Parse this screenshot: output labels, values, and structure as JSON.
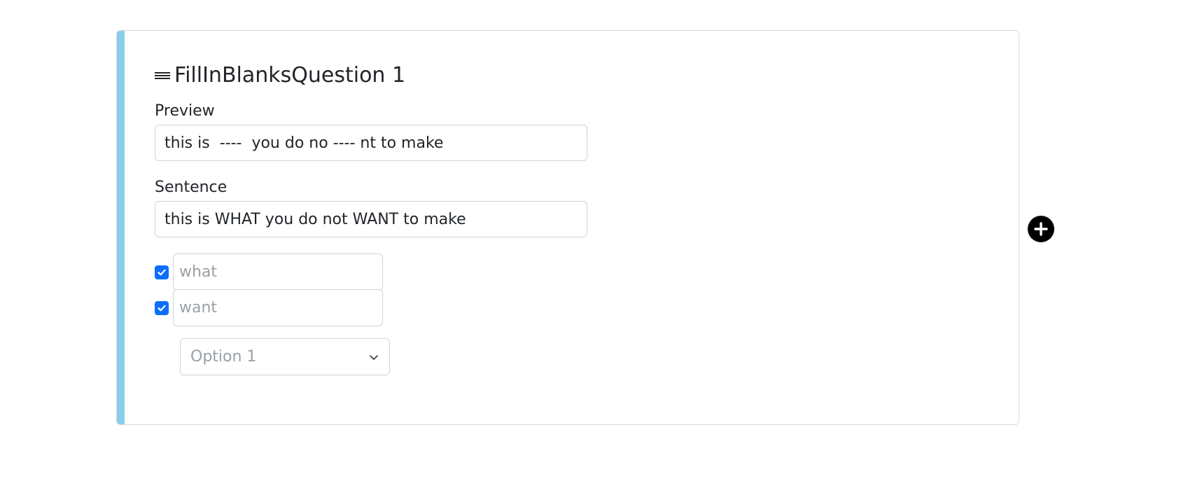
{
  "question": {
    "title": "FillInBlanksQuestion 1",
    "drag_icon": "drag-handle-icon",
    "accent_color": "#87ceeb"
  },
  "preview": {
    "label": "Preview",
    "value": "this is  ----  you do no ---- nt to make"
  },
  "sentence": {
    "label": "Sentence",
    "value": "this is WHAT you do not WANT to make"
  },
  "blanks": [
    {
      "checked": true,
      "placeholder": "what"
    },
    {
      "checked": true,
      "placeholder": "want"
    }
  ],
  "select": {
    "selected": "Option 1",
    "icon": "chevron-down-icon"
  },
  "add_button": {
    "icon": "plus-circle-icon"
  },
  "colors": {
    "checkbox": "#0d6efd",
    "add_button": "#000000"
  }
}
